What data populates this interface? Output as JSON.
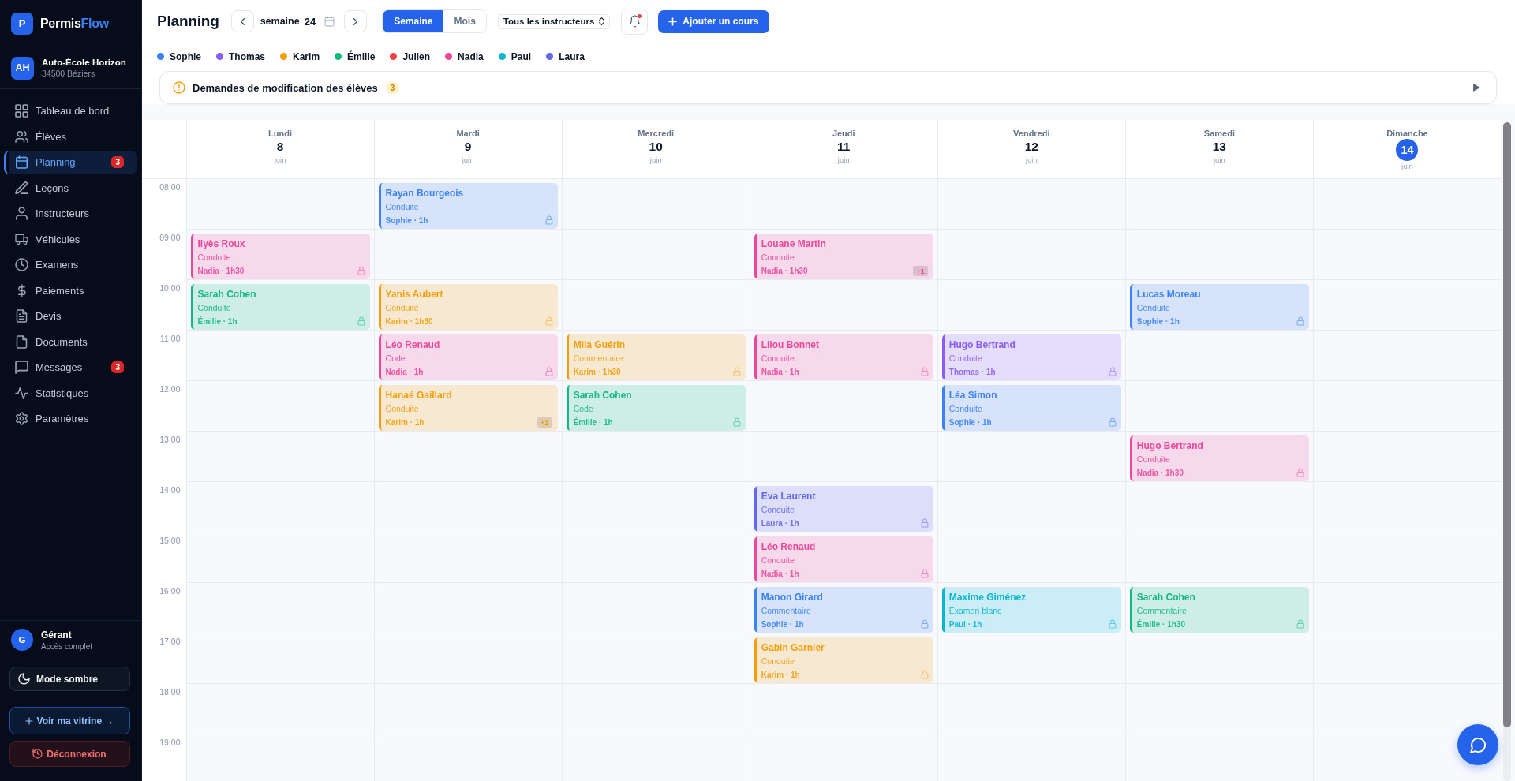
{
  "sidebar": {
    "logo": {
      "letter": "P",
      "name": "Permis",
      "name_accent": "Flow"
    },
    "school": {
      "initials": "AH",
      "name": "Auto-École Horizon",
      "location": "34500 Béziers"
    },
    "items": [
      {
        "label": "Tableau de bord",
        "selected": false
      },
      {
        "label": "Élèves",
        "selected": false
      },
      {
        "label": "Planning",
        "selected": true,
        "badge": "3"
      },
      {
        "label": "Leçons",
        "selected": false
      },
      {
        "label": "Instructeurs",
        "selected": false
      },
      {
        "label": "Véhicules",
        "selected": false
      },
      {
        "label": "Examens",
        "selected": false
      },
      {
        "label": "Paiements",
        "selected": false
      },
      {
        "label": "Devis",
        "selected": false
      },
      {
        "label": "Documents",
        "selected": false
      },
      {
        "label": "Messages",
        "selected": false,
        "badge": "3"
      },
      {
        "label": "Statistiques",
        "selected": false
      },
      {
        "label": "Paramètres",
        "selected": false
      }
    ],
    "user": {
      "initials": "G",
      "name": "Gérant",
      "role": "Accès complet"
    },
    "buttons": [
      {
        "kind": "theme",
        "label": "Mode sombre"
      },
      {
        "kind": "showcase",
        "label": "Voir ma vitrine →"
      },
      {
        "kind": "logout",
        "label": "Déconnexion"
      }
    ]
  },
  "header": {
    "title": "Planning",
    "week_label": "semaine",
    "week_number": "24",
    "views": [
      {
        "label": "Semaine",
        "selected": true
      },
      {
        "label": "Mois",
        "selected": false
      }
    ],
    "instructor_filter": "Tous les instructeurs",
    "bell": {
      "unread": true
    },
    "add_button": {
      "label": "Ajouter un cours"
    }
  },
  "instructors": [
    {
      "name": "Sophie",
      "color": "#3b82f6"
    },
    {
      "name": "Thomas",
      "color": "#8b5cf6"
    },
    {
      "name": "Karim",
      "color": "#f59e0b"
    },
    {
      "name": "Émilie",
      "color": "#10b981"
    },
    {
      "name": "Julien",
      "color": "#ef4444"
    },
    {
      "name": "Nadia",
      "color": "#ec4899"
    },
    {
      "name": "Paul",
      "color": "#06b6d4"
    },
    {
      "name": "Laura",
      "color": "#6366f1"
    }
  ],
  "requests_banner": {
    "title": "Demandes de modification des élèves",
    "count": "3",
    "expanded": false
  },
  "calendar": {
    "days": [
      {
        "weekday": "Lundi",
        "day": "8",
        "month": "juin",
        "today": false
      },
      {
        "weekday": "Mardi",
        "day": "9",
        "month": "juin",
        "today": false
      },
      {
        "weekday": "Mercredi",
        "day": "10",
        "month": "juin",
        "today": false
      },
      {
        "weekday": "Jeudi",
        "day": "11",
        "month": "juin",
        "today": false
      },
      {
        "weekday": "Vendredi",
        "day": "12",
        "month": "juin",
        "today": false
      },
      {
        "weekday": "Samedi",
        "day": "13",
        "month": "juin",
        "today": false
      },
      {
        "weekday": "Dimanche",
        "day": "14",
        "month": "juin",
        "today": true
      }
    ],
    "rows": [
      {
        "time": "08:00",
        "cells": [
          null,
          {
            "student": "Rayan Bourgeois",
            "lesson": "Conduite",
            "details": "Sophie · 1h",
            "color": "#3b82f6",
            "locked": true
          },
          null,
          null,
          null,
          null,
          null
        ]
      },
      {
        "time": "09:00",
        "cells": [
          {
            "student": "Ilyès Roux",
            "lesson": "Conduite",
            "details": "Nadia · 1h30",
            "color": "#ec4899",
            "locked": true
          },
          null,
          null,
          {
            "student": "Louane Martin",
            "lesson": "Conduite",
            "details": "Nadia · 1h30",
            "color": "#ec4899",
            "locked": false,
            "extra": "+1"
          },
          null,
          null,
          null
        ]
      },
      {
        "time": "10:00",
        "cells": [
          {
            "student": "Sarah Cohen",
            "lesson": "Conduite",
            "details": "Émilie · 1h",
            "color": "#10b981",
            "locked": true
          },
          {
            "student": "Yanis Aubert",
            "lesson": "Conduite",
            "details": "Karim · 1h30",
            "color": "#f59e0b",
            "locked": true
          },
          null,
          null,
          null,
          {
            "student": "Lucas Moreau",
            "lesson": "Conduite",
            "details": "Sophie · 1h",
            "color": "#3b82f6",
            "locked": true
          },
          null
        ]
      },
      {
        "time": "11:00",
        "cells": [
          null,
          {
            "student": "Léo Renaud",
            "lesson": "Code",
            "details": "Nadia · 1h",
            "color": "#ec4899",
            "locked": true
          },
          {
            "student": "Mila Guérin",
            "lesson": "Commentaire",
            "details": "Karim · 1h30",
            "color": "#f59e0b",
            "locked": true
          },
          {
            "student": "Lilou Bonnet",
            "lesson": "Conduite",
            "details": "Nadia · 1h",
            "color": "#ec4899",
            "locked": true
          },
          {
            "student": "Hugo Bertrand",
            "lesson": "Conduite",
            "details": "Thomas · 1h",
            "color": "#8b5cf6",
            "locked": true
          },
          null,
          null
        ]
      },
      {
        "time": "12:00",
        "cells": [
          null,
          {
            "student": "Hanaé Gaillard",
            "lesson": "Conduite",
            "details": "Karim · 1h",
            "color": "#f59e0b",
            "locked": false,
            "extra": "+1"
          },
          {
            "student": "Sarah Cohen",
            "lesson": "Code",
            "details": "Émilie · 1h",
            "color": "#10b981",
            "locked": true
          },
          null,
          {
            "student": "Léa Simon",
            "lesson": "Conduite",
            "details": "Sophie · 1h",
            "color": "#3b82f6",
            "locked": true
          },
          null,
          null
        ]
      },
      {
        "time": "13:00",
        "cells": [
          null,
          null,
          null,
          null,
          null,
          {
            "student": "Hugo Bertrand",
            "lesson": "Conduite",
            "details": "Nadia · 1h30",
            "color": "#ec4899",
            "locked": true
          },
          null
        ]
      },
      {
        "time": "14:00",
        "cells": [
          null,
          null,
          null,
          {
            "student": "Eva Laurent",
            "lesson": "Conduite",
            "details": "Laura · 1h",
            "color": "#6366f1",
            "locked": true
          },
          null,
          null,
          null
        ]
      },
      {
        "time": "15:00",
        "cells": [
          null,
          null,
          null,
          {
            "student": "Léo Renaud",
            "lesson": "Conduite",
            "details": "Nadia · 1h",
            "color": "#ec4899",
            "locked": true
          },
          null,
          null,
          null
        ]
      },
      {
        "time": "16:00",
        "cells": [
          null,
          null,
          null,
          {
            "student": "Manon Girard",
            "lesson": "Commentaire",
            "details": "Sophie · 1h",
            "color": "#3b82f6",
            "locked": true
          },
          {
            "student": "Maxime Giménez",
            "lesson": "Examen blanc",
            "details": "Paul · 1h",
            "color": "#06b6d4",
            "locked": true
          },
          {
            "student": "Sarah Cohen",
            "lesson": "Commentaire",
            "details": "Émilie · 1h30",
            "color": "#10b981",
            "locked": true
          },
          null
        ]
      },
      {
        "time": "17:00",
        "cells": [
          null,
          null,
          null,
          {
            "student": "Gabin Garnier",
            "lesson": "Conduite",
            "details": "Karim · 1h",
            "color": "#f59e0b",
            "locked": true
          },
          null,
          null,
          null
        ]
      },
      {
        "time": "18:00",
        "cells": [
          null,
          null,
          null,
          null,
          null,
          null,
          null
        ]
      },
      {
        "time": "19:00",
        "cells": [
          null,
          null,
          null,
          null,
          null,
          null,
          null
        ]
      }
    ]
  }
}
